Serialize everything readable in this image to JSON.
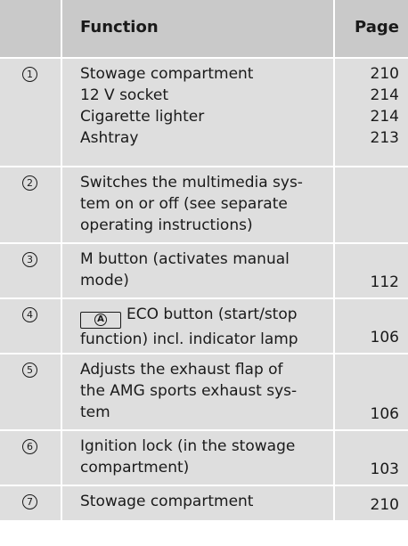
{
  "header": {
    "function": "Function",
    "page": "Page"
  },
  "rows": [
    {
      "marker": "1",
      "items": [
        {
          "text": "Stowage compartment",
          "page": "210"
        },
        {
          "text": "12 V socket",
          "page": "214"
        },
        {
          "text": "Cigarette lighter",
          "page": "214"
        },
        {
          "text": "Ashtray",
          "page": "213"
        }
      ]
    },
    {
      "marker": "2",
      "lines": [
        "Switches the multimedia sys-",
        "tem on or off (see separate",
        "operating instructions)"
      ],
      "page": ""
    },
    {
      "marker": "3",
      "lines": [
        "M button (activates manual",
        "mode)"
      ],
      "page": "112"
    },
    {
      "marker": "4",
      "key_label": "A",
      "lines": [
        "ECO button (start/stop",
        "function) incl. indicator lamp"
      ],
      "page": "106"
    },
    {
      "marker": "5",
      "lines": [
        "Adjusts the exhaust flap of",
        "the AMG sports exhaust sys-",
        "tem"
      ],
      "page": "106"
    },
    {
      "marker": "6",
      "lines": [
        "Ignition lock (in the stowage",
        "compartment)"
      ],
      "page": "103"
    },
    {
      "marker": "7",
      "lines": [
        "Stowage compartment"
      ],
      "page": "210"
    }
  ]
}
